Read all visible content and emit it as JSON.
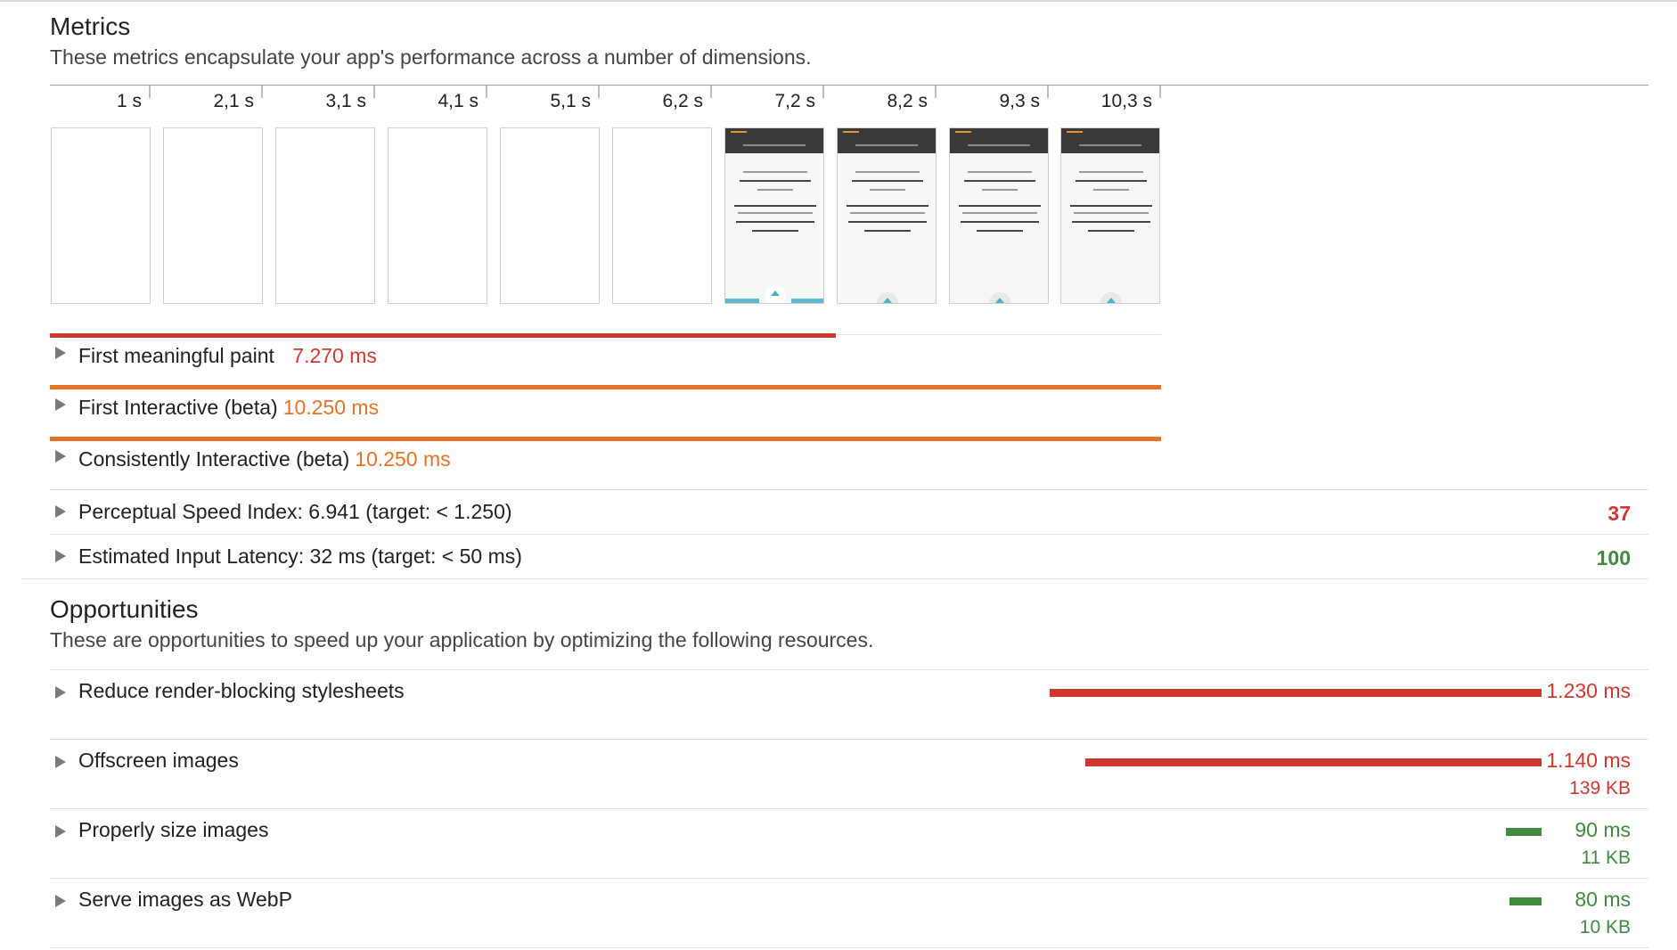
{
  "colors": {
    "red": "#d0382f",
    "orange": "#e67226",
    "green": "#3f8a3f"
  },
  "metrics": {
    "title": "Metrics",
    "description": "These metrics encapsulate your app's performance across a number of dimensions.",
    "timeline_labels": [
      "1 s",
      "2,1 s",
      "3,1 s",
      "4,1 s",
      "5,1 s",
      "6,2 s",
      "7,2 s",
      "8,2 s",
      "9,3 s",
      "10,3 s"
    ],
    "items": [
      {
        "label": "First meaningful paint",
        "value": "7.270 ms",
        "status": "red",
        "bar_fraction": 0.708
      },
      {
        "label": "First Interactive (beta)",
        "value": "10.250 ms",
        "status": "orange",
        "bar_fraction": 1.0
      },
      {
        "label": "Consistently Interactive (beta)",
        "value": "10.250 ms",
        "status": "orange",
        "bar_fraction": 1.0
      },
      {
        "label": "Perceptual Speed Index: 6.941 (target: < 1.250)",
        "score": "37",
        "status": "red"
      },
      {
        "label": "Estimated Input Latency: 32 ms (target: < 50 ms)",
        "score": "100",
        "status": "green"
      }
    ]
  },
  "opportunities": {
    "title": "Opportunities",
    "description": "These are opportunities to speed up your application by optimizing the following resources.",
    "items": [
      {
        "label": "Reduce render-blocking stylesheets",
        "time": "1.230 ms",
        "size": "",
        "status": "red",
        "bar_fraction": 1.0
      },
      {
        "label": "Offscreen images",
        "time": "1.140 ms",
        "size": "139 KB",
        "status": "red",
        "bar_fraction": 0.927
      },
      {
        "label": "Properly size images",
        "time": "90 ms",
        "size": "11 KB",
        "status": "green",
        "bar_fraction": 0.073
      },
      {
        "label": "Serve images as WebP",
        "time": "80 ms",
        "size": "10 KB",
        "status": "green",
        "bar_fraction": 0.065
      }
    ]
  }
}
